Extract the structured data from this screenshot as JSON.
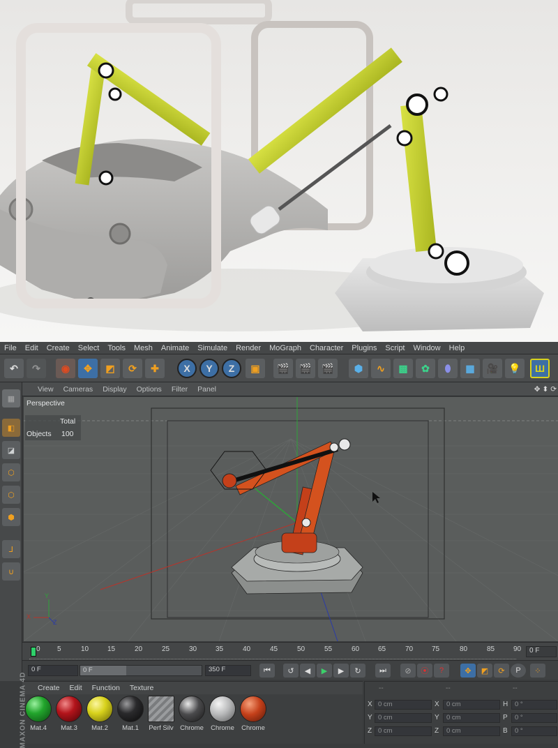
{
  "menu": [
    "File",
    "Edit",
    "Create",
    "Select",
    "Tools",
    "Mesh",
    "Animate",
    "Simulate",
    "Render",
    "MoGraph",
    "Character",
    "Plugins",
    "Script",
    "Window",
    "Help"
  ],
  "viewport_menu": [
    "View",
    "Cameras",
    "Display",
    "Options",
    "Filter",
    "Panel"
  ],
  "viewport": {
    "name": "Perspective",
    "stats_header": "Total",
    "stats_label": "Objects",
    "stats_value": "100"
  },
  "axis_letters": {
    "y": "Y",
    "x": "X",
    "z": "Z"
  },
  "toolbar": {
    "x_label": "X",
    "y_label": "Y",
    "z_label": "Z",
    "p_label": "P"
  },
  "timeline": {
    "ticks": [
      "0",
      "5",
      "10",
      "15",
      "20",
      "25",
      "30",
      "35",
      "40",
      "45",
      "50",
      "55",
      "60",
      "65",
      "70",
      "75",
      "80",
      "85",
      "90"
    ],
    "current": "0 F"
  },
  "transport": {
    "start": "0 F",
    "current": "0 F",
    "end": "350 F"
  },
  "material_menu": [
    "Create",
    "Edit",
    "Function",
    "Texture"
  ],
  "materials": [
    {
      "name": "Mat.4",
      "color": "#22a52c"
    },
    {
      "name": "Mat.3",
      "color": "#b3141b"
    },
    {
      "name": "Mat.2",
      "color": "#d8d21c"
    },
    {
      "name": "Mat.1",
      "color": "#2a2a2c"
    },
    {
      "name": "Perf Silv",
      "color": "#8f9193"
    },
    {
      "name": "Chrome",
      "color": "#4a4a4c"
    },
    {
      "name": "Chrome",
      "color": "#b8b9ba"
    },
    {
      "name": "Chrome",
      "color": "#c4401a"
    }
  ],
  "coords": {
    "headers": [
      "--",
      "--",
      "--"
    ],
    "rows": [
      {
        "a": "X",
        "av": "0 cm",
        "b": "X",
        "bv": "0 cm",
        "c": "H",
        "cv": "0 °"
      },
      {
        "a": "Y",
        "av": "0 cm",
        "b": "Y",
        "bv": "0 cm",
        "c": "P",
        "cv": "0 °"
      },
      {
        "a": "Z",
        "av": "0 cm",
        "b": "Z",
        "bv": "0 cm",
        "c": "B",
        "cv": "0 °"
      }
    ]
  },
  "brand": "MAXON CINEMA 4D",
  "colors": {
    "accent_orange": "#e06a20",
    "arm_yellow": "#c5d234",
    "grid": "#5a5d5c"
  }
}
